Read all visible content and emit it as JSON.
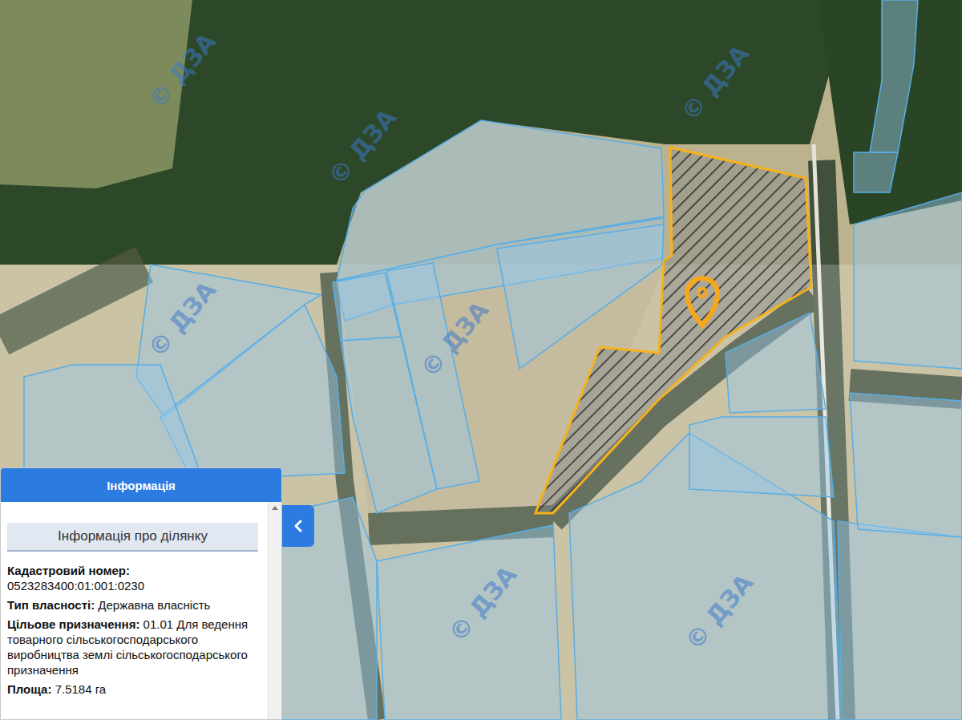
{
  "map": {
    "watermark": "© ДЗА",
    "selected_parcel": {
      "selected": true
    }
  },
  "panel": {
    "title": "Інформація",
    "subtitle": "Інформація про ділянку",
    "collapsed": false,
    "fields": [
      {
        "label": "Кадастровий номер:",
        "value": "0523283400:01:001:0230",
        "kind": "block"
      },
      {
        "label": "Тип власності:",
        "value": "Державна власність",
        "kind": "inline"
      },
      {
        "label": "Цільове призначення:",
        "value": "01.01 Для ведення товарного сільськогосподарського виробництва землі сільськогосподарського призначення",
        "kind": "inline"
      },
      {
        "label": "Площа:",
        "value": "7.5184 га",
        "kind": "inline"
      }
    ]
  }
}
